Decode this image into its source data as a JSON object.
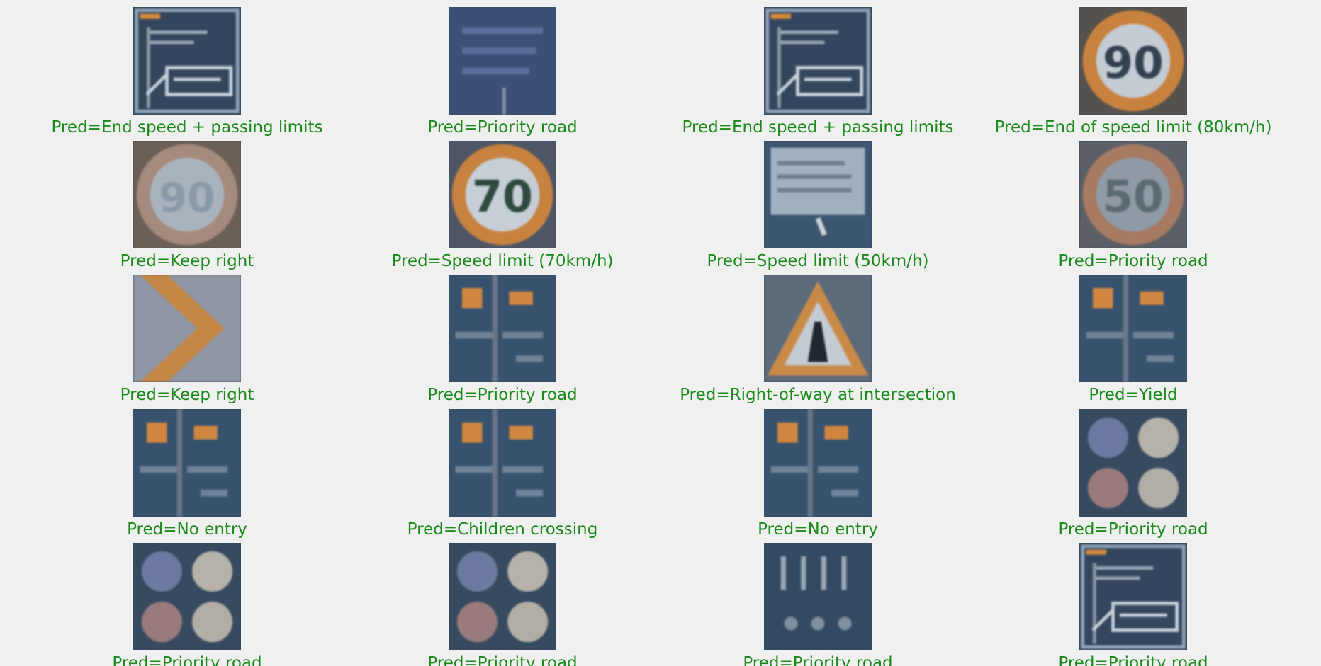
{
  "grid": {
    "predictions": [
      {
        "caption": "Pred=End speed + passing limits",
        "thumb": "board-icon",
        "color": "#1a8a1a"
      },
      {
        "caption": "Pred=Priority road",
        "thumb": "blue-panel-icon",
        "color": "#1a8a1a"
      },
      {
        "caption": "Pred=End speed + passing limits",
        "thumb": "board-icon",
        "color": "#1a8a1a"
      },
      {
        "caption": "Pred=End of speed limit (80km/h)",
        "thumb": "speed-90-icon",
        "color": "#1a8a1a"
      },
      {
        "caption": "Pred=Keep right",
        "thumb": "blurry-circle-icon",
        "color": "#1a8a1a"
      },
      {
        "caption": "Pred=Speed limit (70km/h)",
        "thumb": "speed-70-icon",
        "color": "#1a8a1a"
      },
      {
        "caption": "Pred=Speed limit (50km/h)",
        "thumb": "text-board-icon",
        "color": "#1a8a1a"
      },
      {
        "caption": "Pred=Priority road",
        "thumb": "speed-50-icon",
        "color": "#1a8a1a"
      },
      {
        "caption": "Pred=Keep right",
        "thumb": "chevron-right-icon",
        "color": "#1a8a1a"
      },
      {
        "caption": "Pred=Priority road",
        "thumb": "highway-panel-icon",
        "color": "#1a8a1a"
      },
      {
        "caption": "Pred=Right-of-way at intersection",
        "thumb": "warning-triangle-icon",
        "color": "#1a8a1a"
      },
      {
        "caption": "Pred=Yield",
        "thumb": "highway-panel-icon",
        "color": "#1a8a1a"
      },
      {
        "caption": "Pred=No entry",
        "thumb": "highway-panel-icon",
        "color": "#1a8a1a"
      },
      {
        "caption": "Pred=Children crossing",
        "thumb": "highway-panel-icon",
        "color": "#1a8a1a"
      },
      {
        "caption": "Pred=No entry",
        "thumb": "highway-panel-icon",
        "color": "#1a8a1a"
      },
      {
        "caption": "Pred=Priority road",
        "thumb": "four-signs-icon",
        "color": "#1a8a1a"
      },
      {
        "caption": "Pred=Priority road",
        "thumb": "four-signs-icon",
        "color": "#1a8a1a"
      },
      {
        "caption": "Pred=Priority road",
        "thumb": "four-signs-icon",
        "color": "#1a8a1a"
      },
      {
        "caption": "Pred=Priority road",
        "thumb": "lane-board-icon",
        "color": "#1a8a1a"
      },
      {
        "caption": "Pred=Priority road",
        "thumb": "board-icon",
        "color": "#1a8a1a"
      }
    ]
  }
}
